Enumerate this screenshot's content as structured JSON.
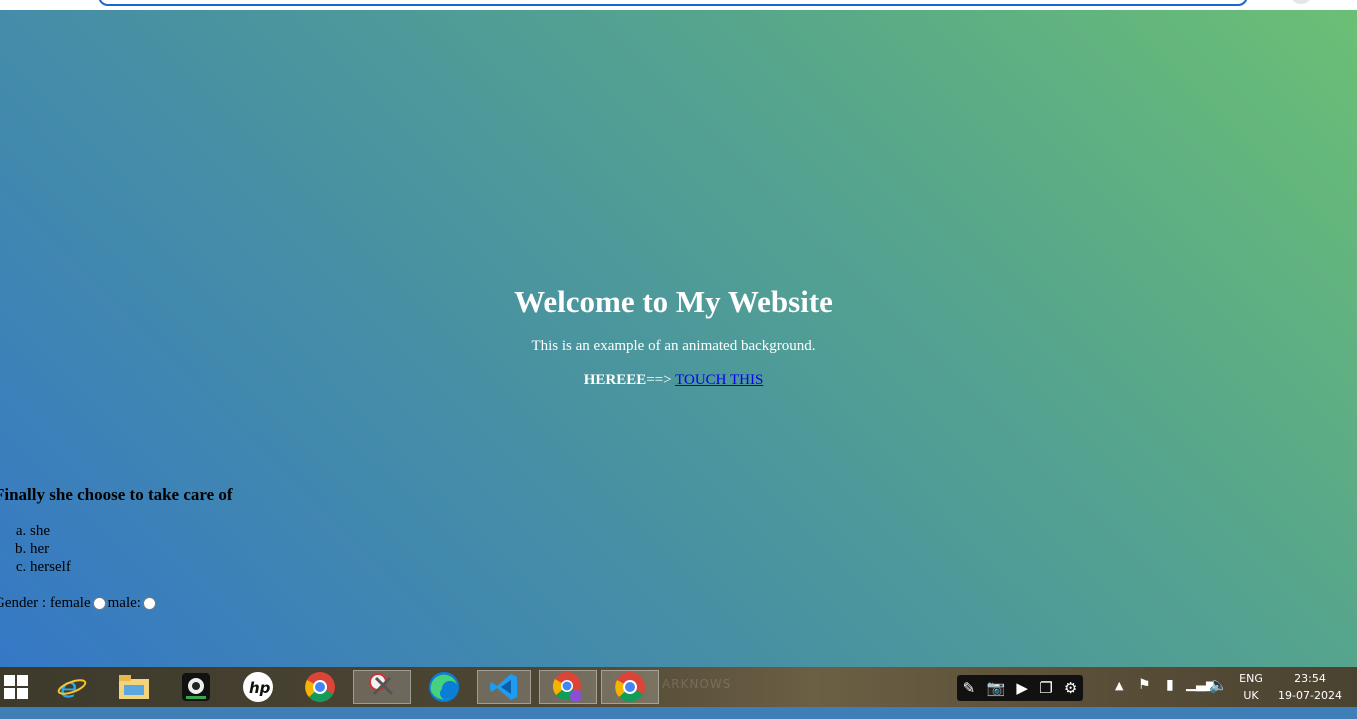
{
  "hero": {
    "title": "Welcome to My Website",
    "subtitle": "This is an example of an animated background.",
    "cta_prefix": "HEREEE",
    "cta_arrow": "==>",
    "cta_link": "TOUCH THIS"
  },
  "quiz": {
    "question": "Finally she choose to take care of",
    "options": [
      "she",
      "her",
      "herself"
    ]
  },
  "gender": {
    "label": "Gender :",
    "female_label": "female",
    "male_label": "male:"
  },
  "taskbar": {
    "icons": [
      "windows-start",
      "internet-explorer",
      "file-explorer",
      "webcam-app",
      "hp-app",
      "chrome",
      "snipping-tool",
      "edge",
      "vscode",
      "chrome-profile",
      "chrome-active"
    ],
    "wallpaper_text": "ARKNOWS",
    "tray_language": "ENG",
    "tray_region": "UK",
    "time": "23:54",
    "date": "19-07-2024"
  },
  "colors": {
    "gradient_start": "#6bbf74",
    "gradient_end": "#3578c6",
    "link": "#0000ee"
  }
}
